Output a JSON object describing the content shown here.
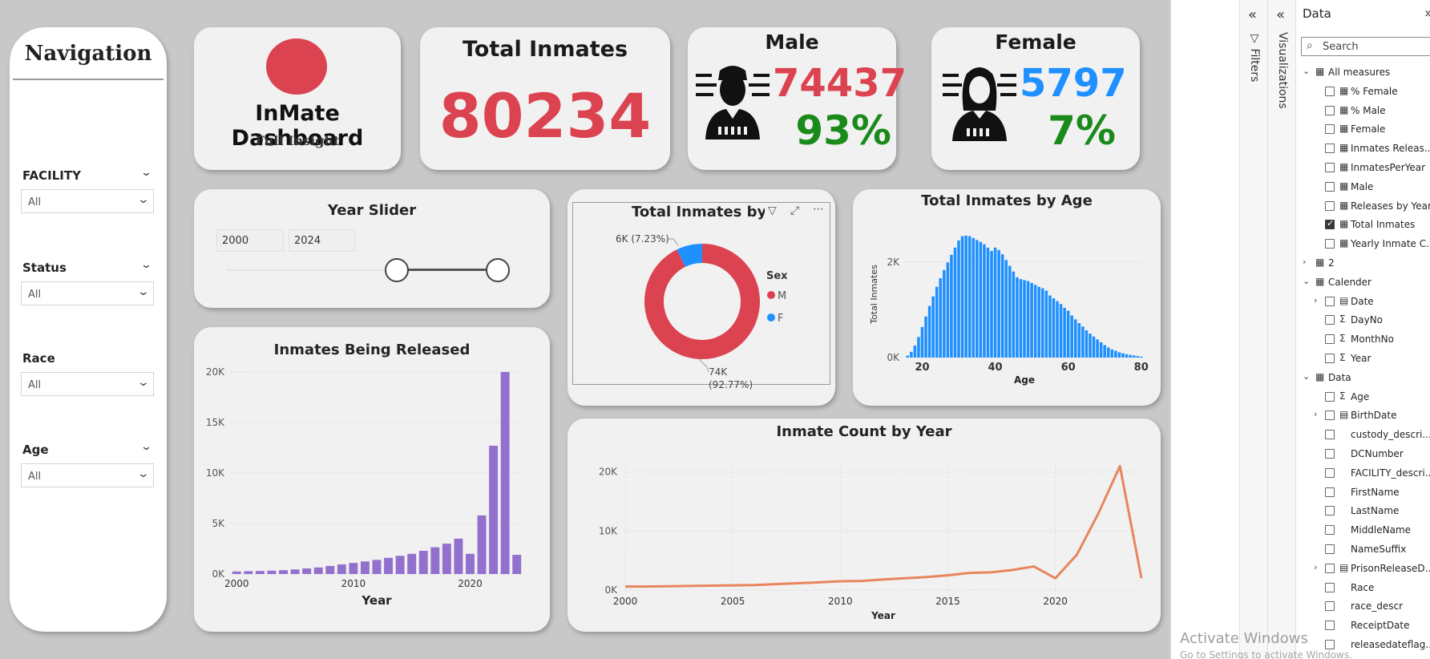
{
  "navigation": {
    "title": "Navigation",
    "slicers": [
      {
        "label": "FACILITY",
        "value": "All"
      },
      {
        "label": "Status",
        "value": "All"
      },
      {
        "label": "Race",
        "value": "All"
      },
      {
        "label": "Age",
        "value": "All"
      }
    ]
  },
  "header_card": {
    "title": "InMate Dashboard",
    "subtitle": "Full Insight",
    "dot_color": "#dc4350"
  },
  "total_card": {
    "title": "Total Inmates",
    "value": "80234",
    "color": "#dc4350"
  },
  "male_card": {
    "title": "Male",
    "count": "74437",
    "percent": "93%",
    "count_color": "#dc4350",
    "percent_color": "#1a8a1a",
    "icon": "male-inmate-icon"
  },
  "female_card": {
    "title": "Female",
    "count": "5797",
    "percent": "7%",
    "count_color": "#1e90ff",
    "percent_color": "#1a8a1a",
    "icon": "female-inmate-icon"
  },
  "year_slider": {
    "title": "Year Slider",
    "from": "2000",
    "to": "2024"
  },
  "charts": {
    "released": {
      "title": "Inmates Being Released",
      "chart_data": {
        "type": "bar",
        "xlabel": "Year",
        "x_ticks": [
          "2000",
          "2010",
          "2020"
        ],
        "y_ticks": [
          "20K",
          "15K",
          "10K",
          "5K",
          "0K"
        ],
        "ylim": [
          0,
          20000
        ],
        "color": "#9270ce",
        "x": [
          2000,
          2001,
          2002,
          2003,
          2004,
          2005,
          2006,
          2007,
          2008,
          2009,
          2010,
          2011,
          2012,
          2013,
          2014,
          2015,
          2016,
          2017,
          2018,
          2019,
          2020,
          2021,
          2022,
          2023,
          2024
        ],
        "values": [
          250,
          280,
          300,
          330,
          380,
          450,
          550,
          650,
          800,
          950,
          1100,
          1250,
          1400,
          1600,
          1800,
          2000,
          2300,
          2650,
          3000,
          3500,
          2000,
          5800,
          12700,
          20000,
          1900
        ]
      }
    },
    "by_sex": {
      "title": "Total Inmates by Sex",
      "chart_data": {
        "type": "pie",
        "legend_title": "Sex",
        "slices": [
          {
            "name": "M",
            "value": 74437,
            "label": "74K",
            "pct_label": "(92.77%)",
            "color": "#dc4350"
          },
          {
            "name": "F",
            "value": 5797,
            "label": "6K (7.23%)",
            "color": "#1e90ff"
          }
        ]
      }
    },
    "by_age": {
      "title": "Total Inmates by Age",
      "chart_data": {
        "type": "bar",
        "xlabel": "Age",
        "ylabel": "Total Inmates",
        "x_ticks": [
          "20",
          "40",
          "60",
          "80"
        ],
        "y_ticks": [
          "2K",
          "0K"
        ],
        "ylim": [
          0,
          2650
        ],
        "color": "#1e90ff",
        "x": [
          16,
          17,
          18,
          19,
          20,
          21,
          22,
          23,
          24,
          25,
          26,
          27,
          28,
          29,
          30,
          31,
          32,
          33,
          34,
          35,
          36,
          37,
          38,
          39,
          40,
          41,
          42,
          43,
          44,
          45,
          46,
          47,
          48,
          49,
          50,
          51,
          52,
          53,
          54,
          55,
          56,
          57,
          58,
          59,
          60,
          61,
          62,
          63,
          64,
          65,
          66,
          67,
          68,
          69,
          70,
          71,
          72,
          73,
          74,
          75,
          76,
          77,
          78,
          79,
          80
        ],
        "values": [
          40,
          120,
          250,
          430,
          640,
          860,
          1080,
          1280,
          1480,
          1660,
          1830,
          1990,
          2150,
          2300,
          2450,
          2540,
          2550,
          2540,
          2500,
          2460,
          2420,
          2370,
          2300,
          2230,
          2300,
          2250,
          2160,
          2040,
          1920,
          1800,
          1680,
          1640,
          1620,
          1600,
          1560,
          1520,
          1480,
          1450,
          1400,
          1300,
          1240,
          1180,
          1120,
          1040,
          980,
          880,
          800,
          720,
          650,
          570,
          500,
          440,
          380,
          320,
          260,
          210,
          170,
          140,
          110,
          90,
          70,
          55,
          45,
          30,
          20
        ]
      }
    },
    "count_by_year": {
      "title": "Inmate Count by Year",
      "chart_data": {
        "type": "line",
        "xlabel": "Year",
        "x_ticks": [
          "2000",
          "2005",
          "2010",
          "2015",
          "2020"
        ],
        "y_ticks": [
          "20K",
          "10K",
          "0K"
        ],
        "ylim": [
          0,
          22000
        ],
        "color": "#e8855d",
        "x": [
          2000,
          2001,
          2002,
          2003,
          2004,
          2005,
          2006,
          2007,
          2008,
          2009,
          2010,
          2011,
          2012,
          2013,
          2014,
          2015,
          2016,
          2017,
          2018,
          2019,
          2020,
          2021,
          2022,
          2023,
          2024
        ],
        "values": [
          600,
          600,
          650,
          700,
          750,
          800,
          850,
          1000,
          1150,
          1300,
          1500,
          1550,
          1800,
          2000,
          2200,
          2500,
          2900,
          3000,
          3400,
          4000,
          2000,
          6000,
          13000,
          21000,
          2000
        ]
      }
    }
  },
  "right_panes": {
    "filters_label": "Filters",
    "visualizations_label": "Visualizations",
    "data_label": "Data",
    "search_placeholder": "Search",
    "fields": [
      {
        "name": "All measures",
        "kind": "table",
        "expanded": true,
        "level": 0
      },
      {
        "name": "% Female",
        "kind": "measure",
        "level": 1,
        "checked": false
      },
      {
        "name": "% Male",
        "kind": "measure",
        "level": 1,
        "checked": false
      },
      {
        "name": "Female",
        "kind": "measure",
        "level": 1,
        "checked": false
      },
      {
        "name": "Inmates Releas...",
        "kind": "measure",
        "level": 1,
        "checked": false
      },
      {
        "name": "InmatesPerYear",
        "kind": "measure",
        "level": 1,
        "checked": false
      },
      {
        "name": "Male",
        "kind": "measure",
        "level": 1,
        "checked": false
      },
      {
        "name": "Releases by Year",
        "kind": "measure",
        "level": 1,
        "checked": false
      },
      {
        "name": "Total Inmates",
        "kind": "measure",
        "level": 1,
        "checked": true
      },
      {
        "name": "Yearly Inmate C...",
        "kind": "measure",
        "level": 1,
        "checked": false
      },
      {
        "name": "2",
        "kind": "table",
        "expanded": false,
        "level": 0
      },
      {
        "name": "Calender",
        "kind": "table",
        "expanded": true,
        "level": 0
      },
      {
        "name": "Date",
        "kind": "date",
        "level": 1,
        "checked": false,
        "expandable": true
      },
      {
        "name": "DayNo",
        "kind": "sum",
        "level": 1,
        "checked": false
      },
      {
        "name": "MonthNo",
        "kind": "sum",
        "level": 1,
        "checked": false
      },
      {
        "name": "Year",
        "kind": "sum",
        "level": 1,
        "checked": false
      },
      {
        "name": "Data",
        "kind": "table",
        "expanded": true,
        "level": 0
      },
      {
        "name": "Age",
        "kind": "sum",
        "level": 1,
        "checked": false
      },
      {
        "name": "BirthDate",
        "kind": "date",
        "level": 1,
        "checked": false,
        "expandable": true
      },
      {
        "name": "custody_descri...",
        "kind": "text",
        "level": 1,
        "checked": false
      },
      {
        "name": "DCNumber",
        "kind": "text",
        "level": 1,
        "checked": false
      },
      {
        "name": "FACILITY_descri...",
        "kind": "text",
        "level": 1,
        "checked": false
      },
      {
        "name": "FirstName",
        "kind": "text",
        "level": 1,
        "checked": false
      },
      {
        "name": "LastName",
        "kind": "text",
        "level": 1,
        "checked": false
      },
      {
        "name": "MiddleName",
        "kind": "text",
        "level": 1,
        "checked": false
      },
      {
        "name": "NameSuffix",
        "kind": "text",
        "level": 1,
        "checked": false
      },
      {
        "name": "PrisonReleaseD...",
        "kind": "date",
        "level": 1,
        "checked": false,
        "expandable": true
      },
      {
        "name": "Race",
        "kind": "text",
        "level": 1,
        "checked": false
      },
      {
        "name": "race_descr",
        "kind": "text",
        "level": 1,
        "checked": false
      },
      {
        "name": "ReceiptDate",
        "kind": "text",
        "level": 1,
        "checked": false
      },
      {
        "name": "releasedateflag...",
        "kind": "text",
        "level": 1,
        "checked": false
      }
    ]
  },
  "watermark": {
    "line1": "Activate Windows",
    "line2": "Go to Settings to activate Windows."
  }
}
